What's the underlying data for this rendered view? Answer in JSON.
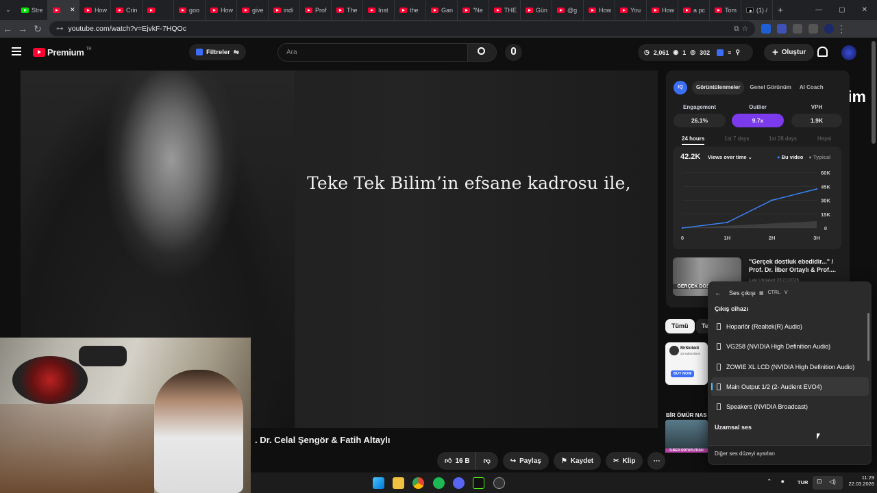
{
  "browser": {
    "tabs": [
      "Stre",
      "",
      "How",
      "Crin",
      "",
      "goo",
      "How",
      "give",
      "indi",
      "Prof",
      "The",
      "Inst",
      "the",
      "Gan",
      "\"Ne",
      "THE",
      "Gün",
      "@g",
      "How",
      "You",
      "How",
      "a pc",
      "Tom",
      "(1) /"
    ],
    "url": "youtube.com/watch?v=EjvkF-7HQOc",
    "new_tab_icon": "plus-icon"
  },
  "youtube": {
    "logo": "Premium",
    "logo_region": "TR",
    "filters": "Filtreler",
    "search_placeholder": "Ara",
    "stats": {
      "views": "2,061",
      "a": "1",
      "b": "302"
    },
    "create": "Oluştur"
  },
  "video": {
    "subtitle": "Teke Tek Bilim’in efsane kadrosu ile,",
    "title": ". Dr. Celal Şengör & Fatih Altaylı",
    "likes": "16 B",
    "share": "Paylaş",
    "save": "Kaydet",
    "clip": "Klip"
  },
  "panel": {
    "tabs": [
      "Görüntülenmeler",
      "Genel Görünüm",
      "AI Coach"
    ],
    "metrics": [
      {
        "label": "Engagement",
        "value": "26.1%"
      },
      {
        "label": "Outlier",
        "value": "9.7x"
      },
      {
        "label": "VPH",
        "value": "1.9K"
      }
    ],
    "ranges": [
      "24 hours",
      "1st 7 days",
      "1st 28 days",
      "Hepsi"
    ],
    "chart_total": "42.2K",
    "chart_mode": "Views over time",
    "legend": [
      "Bu video",
      "Typical"
    ],
    "related_title": "\"Gerçek dostluk ebedidir...\" / Prof. Dr. İlber Ortaylı & Prof....",
    "related_updated": "Last Updated 03/22/2026",
    "thumb_text": "GERÇEK DOSTLUK EBED",
    "chip_all": "Tümü",
    "chip_second": "Te",
    "side_label": "BİR ÖMÜR NAS",
    "side_sub": "İLBER ORTAYLI'DAN",
    "ad_name": "MrSkibidi",
    "ad_subs": "24 subscribers",
    "ad_buy": "BUY NOW"
  },
  "chart_data": {
    "type": "line",
    "x": [
      "0",
      "1H",
      "2H",
      "3H"
    ],
    "series": [
      {
        "name": "Bu video",
        "values": [
          0,
          6000,
          30000,
          42200
        ]
      }
    ],
    "ylim": [
      0,
      60000
    ],
    "yticks": [
      "60K",
      "45K",
      "30K",
      "15K",
      "0"
    ],
    "grid": true,
    "legend_position": "top-right",
    "colors": {
      "line": "#3b82f6",
      "typical": "#555555"
    }
  },
  "audio": {
    "header": "Ses çıkışı",
    "shortcut_keys": [
      "CTRL",
      "V"
    ],
    "section": "Çıkış cihazı",
    "devices": [
      "Hoparlör (Realtek(R) Audio)",
      "VG258 (NVIDIA High Definition Audio)",
      "ZOWIE XL LCD (NVIDIA High Definition Audio)",
      "Main Output 1/2 (2- Audient EVO4)",
      "Speakers (NVIDIA Broadcast)"
    ],
    "spatial": "Uzamsal ses",
    "more": "Diğer ses düzeyi ayarları"
  },
  "taskbar": {
    "lang": "TUR",
    "time": "11:29",
    "date": "22.03.2026"
  },
  "watermark": "Pindirim",
  "colors": {
    "accent": "#7c3aed",
    "yt_red": "#ff0033",
    "link_blue": "#3ea6ff"
  }
}
